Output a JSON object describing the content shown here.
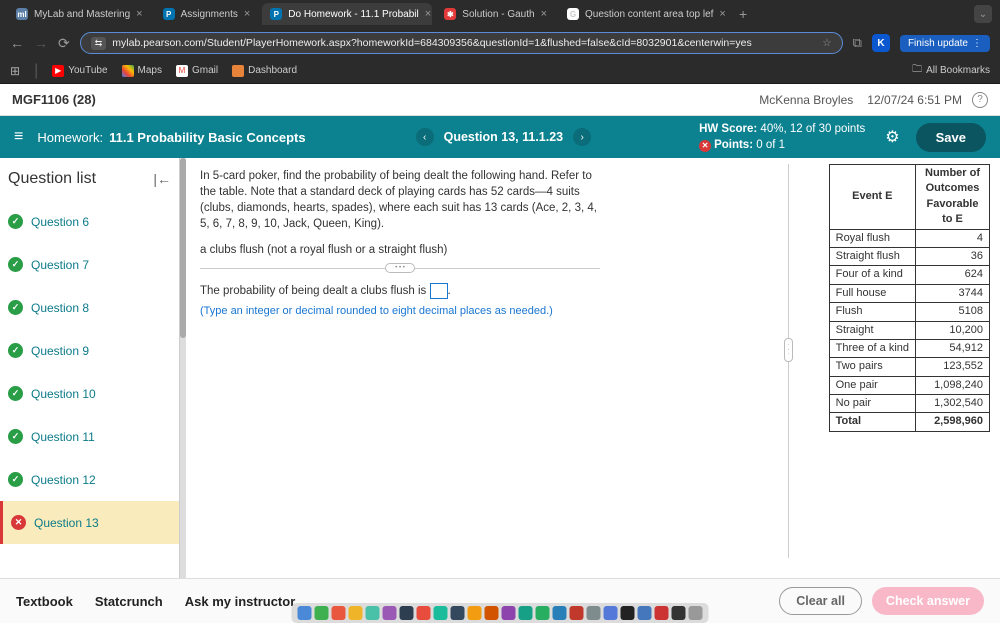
{
  "browser": {
    "tabs": [
      {
        "label": "MyLab and Mastering"
      },
      {
        "label": "Assignments"
      },
      {
        "label": "Do Homework - 11.1 Probabil"
      },
      {
        "label": "Solution - Gauth"
      },
      {
        "label": "Question content area top lef"
      }
    ],
    "url": "mylab.pearson.com/Student/PlayerHomework.aspx?homeworkId=684309356&questionId=1&flushed=false&cId=8032901&centerwin=yes",
    "finish_update": "Finish update",
    "bookmarks": {
      "youtube": "YouTube",
      "maps": "Maps",
      "gmail": "Gmail",
      "dashboard": "Dashboard",
      "all": "All Bookmarks"
    }
  },
  "course": {
    "title": "MGF1106 (28)",
    "user": "McKenna Broyles",
    "date": "12/07/24 6:51 PM"
  },
  "hw": {
    "label": "Homework:",
    "title": "11.1 Probability Basic Concepts",
    "question_label": "Question 13, 11.1.23",
    "score_label": "HW Score:",
    "score_value": "40%, 12 of 30 points",
    "points_label": "Points:",
    "points_value": "0 of 1",
    "save": "Save"
  },
  "sidebar": {
    "title": "Question list",
    "items": [
      {
        "label": "Question 6",
        "status": "ok"
      },
      {
        "label": "Question 7",
        "status": "ok"
      },
      {
        "label": "Question 8",
        "status": "ok"
      },
      {
        "label": "Question 9",
        "status": "ok"
      },
      {
        "label": "Question 10",
        "status": "ok"
      },
      {
        "label": "Question 11",
        "status": "ok"
      },
      {
        "label": "Question 12",
        "status": "ok"
      },
      {
        "label": "Question 13",
        "status": "bad",
        "current": true
      }
    ]
  },
  "question": {
    "p1": "In 5-card poker, find the probability of being dealt the following hand. Refer to the table. Note that a standard deck of playing cards has 52 cards—4 suits (clubs, diamonds, hearts, spades), where each suit has 13 cards (Ace, 2, 3, 4, 5, 6, 7, 8, 9, 10, Jack, Queen, King).",
    "p2": "a clubs flush (not a royal flush or a straight flush)",
    "answer_prefix": "The probability of being dealt a clubs flush is ",
    "answer_suffix": ".",
    "hint": "(Type an integer or decimal rounded to eight decimal places as needed.)"
  },
  "table": {
    "h1": "Event E",
    "h2": "Number of Outcomes Favorable to E",
    "rows": [
      {
        "e": "Royal flush",
        "n": "4"
      },
      {
        "e": "Straight flush",
        "n": "36"
      },
      {
        "e": "Four of a kind",
        "n": "624"
      },
      {
        "e": "Full house",
        "n": "3744"
      },
      {
        "e": "Flush",
        "n": "5108"
      },
      {
        "e": "Straight",
        "n": "10,200"
      },
      {
        "e": "Three of a kind",
        "n": "54,912"
      },
      {
        "e": "Two pairs",
        "n": "123,552"
      },
      {
        "e": "One pair",
        "n": "1,098,240"
      },
      {
        "e": "No pair",
        "n": "1,302,540"
      }
    ],
    "total_label": "Total",
    "total_value": "2,598,960"
  },
  "footer": {
    "textbook": "Textbook",
    "statcrunch": "Statcrunch",
    "ask": "Ask my instructor",
    "clear": "Clear all",
    "check": "Check answer"
  },
  "dock_colors": [
    "#4a88d8",
    "#3fb04f",
    "#e9573f",
    "#f0b429",
    "#49c0a8",
    "#9b59b6",
    "#2c3e50",
    "#e74c3c",
    "#1abc9c",
    "#34495e",
    "#f39c12",
    "#d35400",
    "#8e44ad",
    "#16a085",
    "#27ae60",
    "#2980b9",
    "#c0392b",
    "#7f8c8d",
    "#5579d8",
    "#222",
    "#47b",
    "#c33",
    "#333",
    "#999"
  ]
}
